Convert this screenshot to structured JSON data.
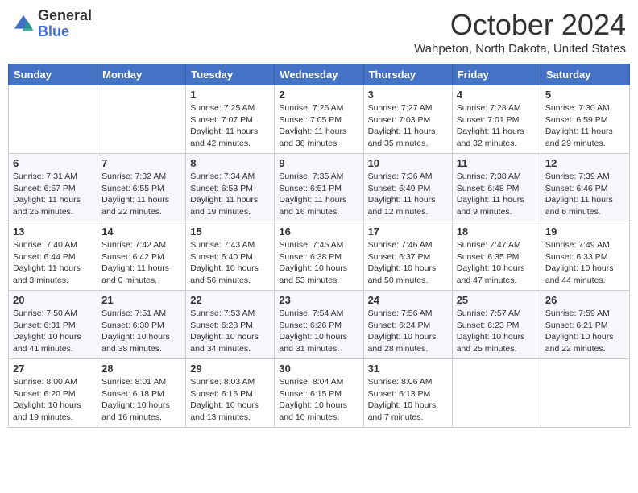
{
  "logo": {
    "general": "General",
    "blue": "Blue"
  },
  "header": {
    "month": "October 2024",
    "location": "Wahpeton, North Dakota, United States"
  },
  "days_of_week": [
    "Sunday",
    "Monday",
    "Tuesday",
    "Wednesday",
    "Thursday",
    "Friday",
    "Saturday"
  ],
  "weeks": [
    [
      {
        "day": "",
        "sunrise": "",
        "sunset": "",
        "daylight": ""
      },
      {
        "day": "",
        "sunrise": "",
        "sunset": "",
        "daylight": ""
      },
      {
        "day": "1",
        "sunrise": "Sunrise: 7:25 AM",
        "sunset": "Sunset: 7:07 PM",
        "daylight": "Daylight: 11 hours and 42 minutes."
      },
      {
        "day": "2",
        "sunrise": "Sunrise: 7:26 AM",
        "sunset": "Sunset: 7:05 PM",
        "daylight": "Daylight: 11 hours and 38 minutes."
      },
      {
        "day": "3",
        "sunrise": "Sunrise: 7:27 AM",
        "sunset": "Sunset: 7:03 PM",
        "daylight": "Daylight: 11 hours and 35 minutes."
      },
      {
        "day": "4",
        "sunrise": "Sunrise: 7:28 AM",
        "sunset": "Sunset: 7:01 PM",
        "daylight": "Daylight: 11 hours and 32 minutes."
      },
      {
        "day": "5",
        "sunrise": "Sunrise: 7:30 AM",
        "sunset": "Sunset: 6:59 PM",
        "daylight": "Daylight: 11 hours and 29 minutes."
      }
    ],
    [
      {
        "day": "6",
        "sunrise": "Sunrise: 7:31 AM",
        "sunset": "Sunset: 6:57 PM",
        "daylight": "Daylight: 11 hours and 25 minutes."
      },
      {
        "day": "7",
        "sunrise": "Sunrise: 7:32 AM",
        "sunset": "Sunset: 6:55 PM",
        "daylight": "Daylight: 11 hours and 22 minutes."
      },
      {
        "day": "8",
        "sunrise": "Sunrise: 7:34 AM",
        "sunset": "Sunset: 6:53 PM",
        "daylight": "Daylight: 11 hours and 19 minutes."
      },
      {
        "day": "9",
        "sunrise": "Sunrise: 7:35 AM",
        "sunset": "Sunset: 6:51 PM",
        "daylight": "Daylight: 11 hours and 16 minutes."
      },
      {
        "day": "10",
        "sunrise": "Sunrise: 7:36 AM",
        "sunset": "Sunset: 6:49 PM",
        "daylight": "Daylight: 11 hours and 12 minutes."
      },
      {
        "day": "11",
        "sunrise": "Sunrise: 7:38 AM",
        "sunset": "Sunset: 6:48 PM",
        "daylight": "Daylight: 11 hours and 9 minutes."
      },
      {
        "day": "12",
        "sunrise": "Sunrise: 7:39 AM",
        "sunset": "Sunset: 6:46 PM",
        "daylight": "Daylight: 11 hours and 6 minutes."
      }
    ],
    [
      {
        "day": "13",
        "sunrise": "Sunrise: 7:40 AM",
        "sunset": "Sunset: 6:44 PM",
        "daylight": "Daylight: 11 hours and 3 minutes."
      },
      {
        "day": "14",
        "sunrise": "Sunrise: 7:42 AM",
        "sunset": "Sunset: 6:42 PM",
        "daylight": "Daylight: 11 hours and 0 minutes."
      },
      {
        "day": "15",
        "sunrise": "Sunrise: 7:43 AM",
        "sunset": "Sunset: 6:40 PM",
        "daylight": "Daylight: 10 hours and 56 minutes."
      },
      {
        "day": "16",
        "sunrise": "Sunrise: 7:45 AM",
        "sunset": "Sunset: 6:38 PM",
        "daylight": "Daylight: 10 hours and 53 minutes."
      },
      {
        "day": "17",
        "sunrise": "Sunrise: 7:46 AM",
        "sunset": "Sunset: 6:37 PM",
        "daylight": "Daylight: 10 hours and 50 minutes."
      },
      {
        "day": "18",
        "sunrise": "Sunrise: 7:47 AM",
        "sunset": "Sunset: 6:35 PM",
        "daylight": "Daylight: 10 hours and 47 minutes."
      },
      {
        "day": "19",
        "sunrise": "Sunrise: 7:49 AM",
        "sunset": "Sunset: 6:33 PM",
        "daylight": "Daylight: 10 hours and 44 minutes."
      }
    ],
    [
      {
        "day": "20",
        "sunrise": "Sunrise: 7:50 AM",
        "sunset": "Sunset: 6:31 PM",
        "daylight": "Daylight: 10 hours and 41 minutes."
      },
      {
        "day": "21",
        "sunrise": "Sunrise: 7:51 AM",
        "sunset": "Sunset: 6:30 PM",
        "daylight": "Daylight: 10 hours and 38 minutes."
      },
      {
        "day": "22",
        "sunrise": "Sunrise: 7:53 AM",
        "sunset": "Sunset: 6:28 PM",
        "daylight": "Daylight: 10 hours and 34 minutes."
      },
      {
        "day": "23",
        "sunrise": "Sunrise: 7:54 AM",
        "sunset": "Sunset: 6:26 PM",
        "daylight": "Daylight: 10 hours and 31 minutes."
      },
      {
        "day": "24",
        "sunrise": "Sunrise: 7:56 AM",
        "sunset": "Sunset: 6:24 PM",
        "daylight": "Daylight: 10 hours and 28 minutes."
      },
      {
        "day": "25",
        "sunrise": "Sunrise: 7:57 AM",
        "sunset": "Sunset: 6:23 PM",
        "daylight": "Daylight: 10 hours and 25 minutes."
      },
      {
        "day": "26",
        "sunrise": "Sunrise: 7:59 AM",
        "sunset": "Sunset: 6:21 PM",
        "daylight": "Daylight: 10 hours and 22 minutes."
      }
    ],
    [
      {
        "day": "27",
        "sunrise": "Sunrise: 8:00 AM",
        "sunset": "Sunset: 6:20 PM",
        "daylight": "Daylight: 10 hours and 19 minutes."
      },
      {
        "day": "28",
        "sunrise": "Sunrise: 8:01 AM",
        "sunset": "Sunset: 6:18 PM",
        "daylight": "Daylight: 10 hours and 16 minutes."
      },
      {
        "day": "29",
        "sunrise": "Sunrise: 8:03 AM",
        "sunset": "Sunset: 6:16 PM",
        "daylight": "Daylight: 10 hours and 13 minutes."
      },
      {
        "day": "30",
        "sunrise": "Sunrise: 8:04 AM",
        "sunset": "Sunset: 6:15 PM",
        "daylight": "Daylight: 10 hours and 10 minutes."
      },
      {
        "day": "31",
        "sunrise": "Sunrise: 8:06 AM",
        "sunset": "Sunset: 6:13 PM",
        "daylight": "Daylight: 10 hours and 7 minutes."
      },
      {
        "day": "",
        "sunrise": "",
        "sunset": "",
        "daylight": ""
      },
      {
        "day": "",
        "sunrise": "",
        "sunset": "",
        "daylight": ""
      }
    ]
  ]
}
